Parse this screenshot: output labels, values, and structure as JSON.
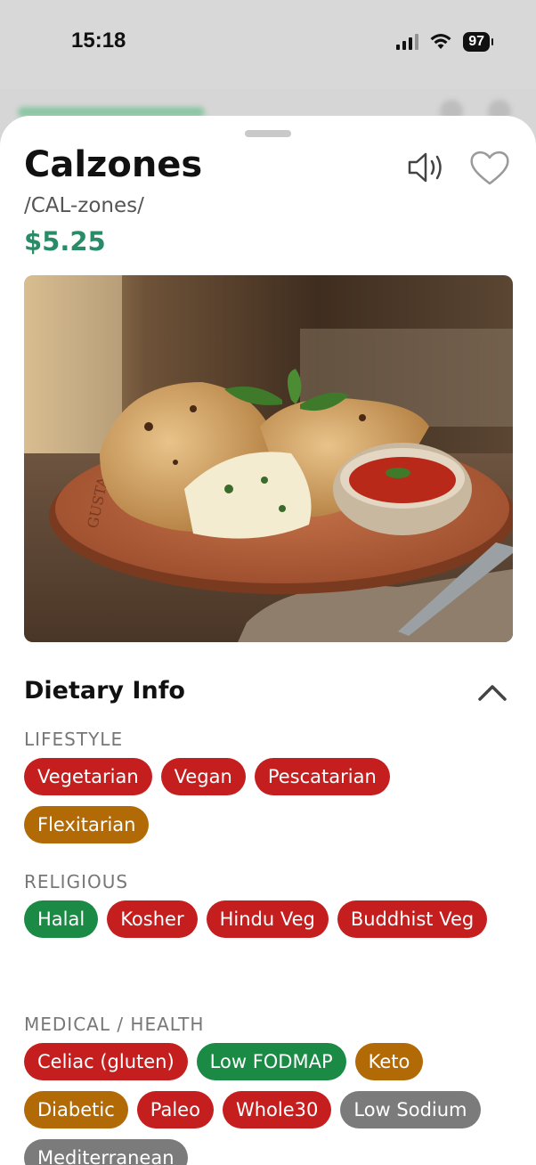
{
  "status_bar": {
    "time": "15:18",
    "battery": "97"
  },
  "dish": {
    "name": "Calzones",
    "pronunciation": "/CAL-zones/",
    "price": "$5.25"
  },
  "image": {
    "plate_text": "GUSTA"
  },
  "dietary": {
    "title": "Dietary Info",
    "groups": [
      {
        "label": "LIFESTYLE",
        "tags": [
          {
            "text": "Vegetarian",
            "status": "red"
          },
          {
            "text": "Vegan",
            "status": "red"
          },
          {
            "text": "Pescatarian",
            "status": "red"
          },
          {
            "text": "Flexitarian",
            "status": "orange"
          }
        ]
      },
      {
        "label": "RELIGIOUS",
        "tags": [
          {
            "text": "Halal",
            "status": "green"
          },
          {
            "text": "Kosher",
            "status": "red"
          },
          {
            "text": "Hindu Veg",
            "status": "red"
          },
          {
            "text": "Buddhist Veg",
            "status": "red"
          }
        ]
      },
      {
        "label": "MEDICAL / HEALTH",
        "tags": [
          {
            "text": "Celiac (gluten)",
            "status": "red"
          },
          {
            "text": "Low FODMAP",
            "status": "green"
          },
          {
            "text": "Keto",
            "status": "orange"
          },
          {
            "text": "Diabetic",
            "status": "orange"
          },
          {
            "text": "Paleo",
            "status": "red"
          },
          {
            "text": "Whole30",
            "status": "red"
          },
          {
            "text": "Low Sodium",
            "status": "gray"
          },
          {
            "text": "Mediterranean",
            "status": "gray"
          }
        ]
      }
    ]
  },
  "colors": {
    "price": "#2a8b68",
    "red": "#c41e1e",
    "orange": "#b26a07",
    "green": "#1a8a45",
    "gray": "#7b7b7b"
  }
}
